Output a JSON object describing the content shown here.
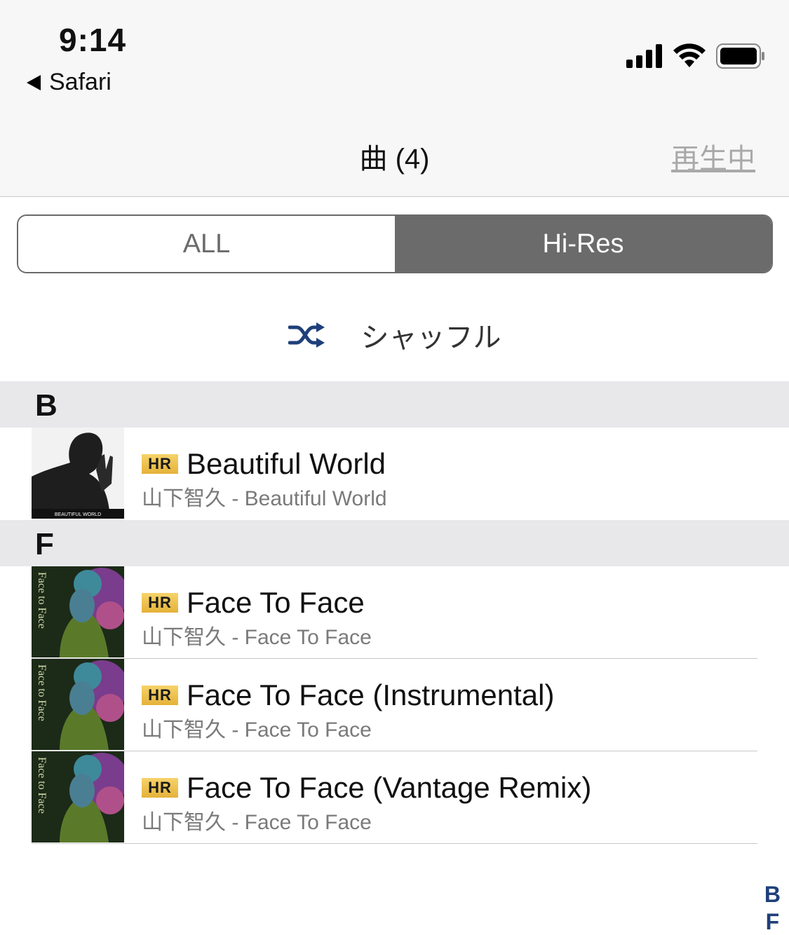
{
  "status": {
    "time": "9:14",
    "back_app": "Safari"
  },
  "nav": {
    "title": "曲 (4)",
    "now_playing": "再生中"
  },
  "segments": {
    "all": "ALL",
    "hires": "Hi-Res",
    "selected": "Hi-Res"
  },
  "shuffle": {
    "label": "シャッフル",
    "icon": "shuffle-icon"
  },
  "hr_badge": "HR",
  "sections": [
    {
      "letter": "B",
      "rows": [
        {
          "title": "Beautiful World",
          "subtitle": "山下智久 - Beautiful World",
          "art_text": "BEAUTIFUL WORLD"
        }
      ]
    },
    {
      "letter": "F",
      "rows": [
        {
          "title": "Face To Face",
          "subtitle": "山下智久 - Face To Face",
          "art_text": "Face to Face"
        },
        {
          "title": "Face To Face (Instrumental)",
          "subtitle": "山下智久 - Face To Face",
          "art_text": "Face to Face"
        },
        {
          "title": "Face To Face (Vantage Remix)",
          "subtitle": "山下智久 - Face To Face",
          "art_text": "Face to Face"
        }
      ]
    }
  ],
  "index": [
    "B",
    "F"
  ],
  "colors": {
    "segment_selected": "#6b6b6b",
    "hr_badge": "#e4b23a",
    "index_text": "#1f3f7a",
    "shuffle_icon": "#1f3f7a"
  }
}
